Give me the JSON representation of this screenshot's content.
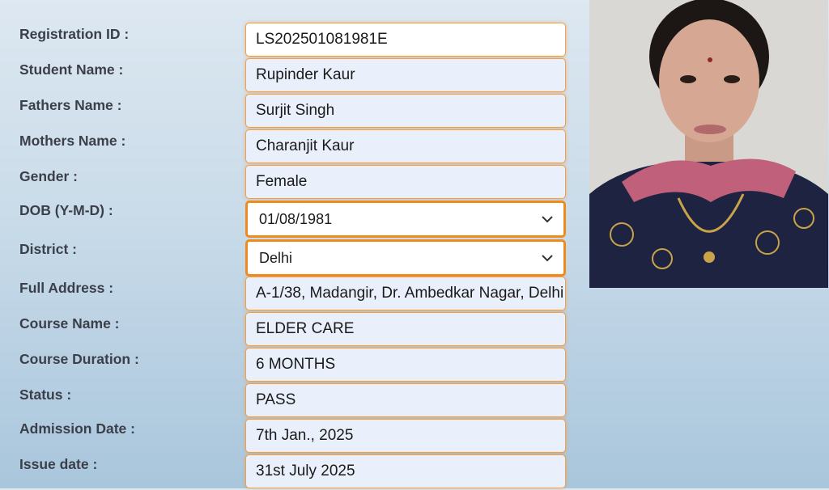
{
  "form": {
    "rows": [
      {
        "label": "Registration ID :",
        "value": "LS202501081981E"
      },
      {
        "label": "Student Name :",
        "value": "Rupinder Kaur"
      },
      {
        "label": "Fathers Name :",
        "value": "Surjit Singh"
      },
      {
        "label": "Mothers Name :",
        "value": "Charanjit Kaur"
      },
      {
        "label": "Gender :",
        "value": "Female"
      },
      {
        "label": "DOB (Y-M-D) :",
        "value": "01/08/1981"
      },
      {
        "label": "District :",
        "value": "Delhi"
      },
      {
        "label": "Full Address :",
        "value": "A-1/38, Madangir, Dr. Ambedkar Nagar, Delhi"
      },
      {
        "label": "Course Name :",
        "value": "ELDER CARE"
      },
      {
        "label": "Course Duration :",
        "value": "6 MONTHS"
      },
      {
        "label": "Status :",
        "value": "PASS"
      },
      {
        "label": "Admission Date :",
        "value": "7th Jan., 2025"
      },
      {
        "label": "Issue date :",
        "value": "31st July 2025"
      }
    ]
  },
  "icons": {
    "dropdown": "chevron-down-icon"
  },
  "colors": {
    "accent": "#f08a1c",
    "field_bg": "#e9f0fb"
  }
}
